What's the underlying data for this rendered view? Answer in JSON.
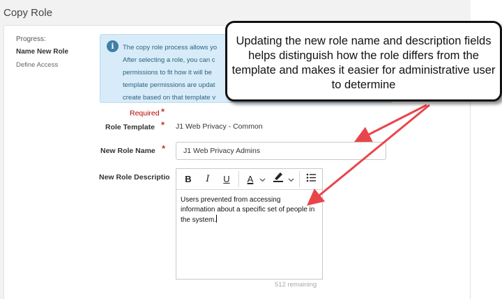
{
  "page": {
    "title": "Copy Role"
  },
  "progress": {
    "label": "Progress:",
    "current_step": "Name New Role",
    "next_step": "Define Access"
  },
  "info": {
    "lines": [
      "The copy role process allows yo",
      "After selecting a role, you can c",
      "permissions to fit how it will be",
      "template permissions are updat",
      "create based on that template v"
    ]
  },
  "form": {
    "required_label": "Required",
    "role_template": {
      "label": "Role Template",
      "value": "J1 Web Privacy - Common"
    },
    "new_role_name": {
      "label": "New Role Name",
      "value": "J1 Web Privacy Admins"
    },
    "new_role_description": {
      "label": "New Role Descriptio",
      "value": "Users prevented from accessing information about a specific set of people in the system.",
      "remaining": "512  remaining"
    }
  },
  "toolbar": {
    "bold": "B",
    "italic": "I",
    "underline": "U",
    "font_color": "A",
    "list": "bulleted-list-icon"
  },
  "callout": {
    "text": "Updating the new role name and description fields helps distinguish how the role differs from the template and makes it easier for administrative user to determine"
  },
  "colors": {
    "required": "#b30000",
    "info_bg": "#d7ecf8",
    "arrow": "#e8454b"
  }
}
